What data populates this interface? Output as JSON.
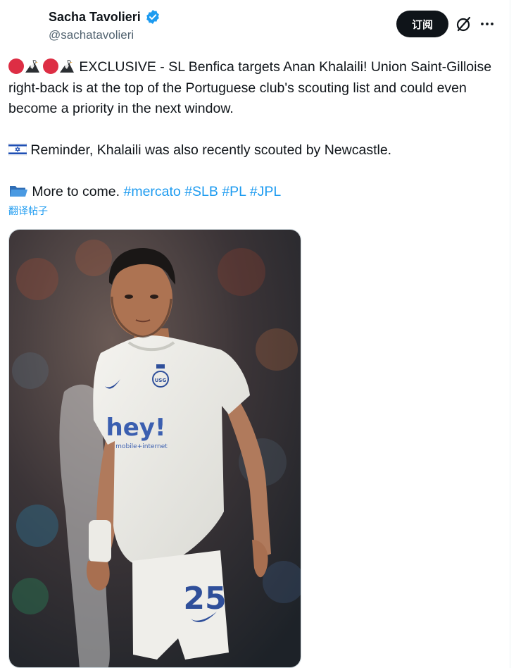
{
  "author": {
    "display_name": "Sacha Tavolieri",
    "handle": "@sachatavolieri",
    "verified": true
  },
  "actions": {
    "subscribe_label": "订阅",
    "grok_icon": "grok-icon",
    "more_icon": "more-icon"
  },
  "tweet": {
    "line1_text": "EXCLUSIVE - SL Benfica targets Anan Khalaili! Union Saint-Gilloise right-back is at the top of the Portuguese club's scouting list and could even become a priority in the next window.",
    "line2_text": "Reminder, Khalaili was also recently scouted by Newcastle.",
    "line3_text": "More to come.",
    "hashtags": [
      "#mercato",
      "#SLB",
      "#PL",
      "#JPL"
    ],
    "emoji_icons": [
      "red-circle-icon",
      "eagle-icon",
      "red-circle-icon",
      "eagle-icon",
      "israel-flag-icon",
      "folder-icon"
    ]
  },
  "translate_label": "翻译帖子",
  "media": {
    "shirt_sponsor": "hey!",
    "shirt_sponsor_sub": "mobile+internet",
    "shirt_number": "25",
    "crest_text": "USG"
  },
  "colors": {
    "accent": "#1d9bf0",
    "text": "#0f1419",
    "secondary": "#536471",
    "button_bg": "#0f1419"
  }
}
